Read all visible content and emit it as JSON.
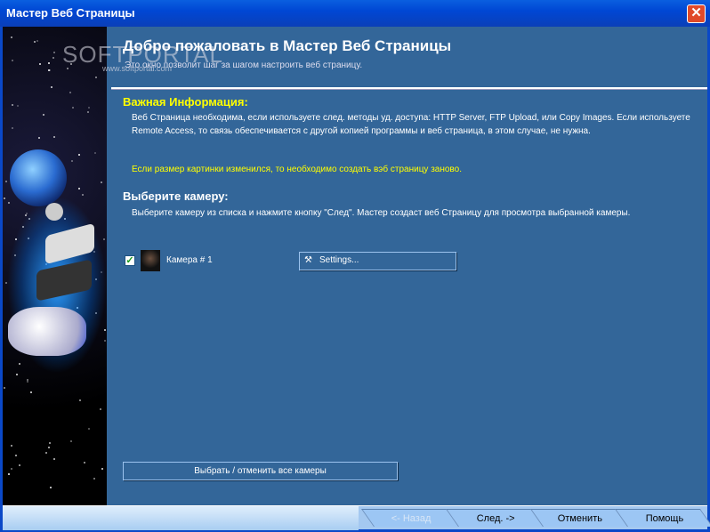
{
  "window": {
    "title": "Мастер Веб Страницы",
    "close": "✕"
  },
  "watermark": {
    "logo": "SOFTPORTAL",
    "url": "www.softportal.com"
  },
  "header": {
    "title": "Добро пожаловать в Мастер Веб Страницы",
    "subtitle": "Это окно позволит шаг за шагом настроить веб страницу."
  },
  "info": {
    "heading": "Важная Информация:",
    "text": "Веб Страница необходима, если используете след. методы уд. доступа: HTTP Server, FTP Upload, или Copy Images. Если используете Remote Access, то связь обеспечивается с другой копией программы и веб страница, в этом случае, не нужна.",
    "warning": "Если размер картинки изменился, то необходимо создать вэб страницу заново."
  },
  "camera": {
    "heading": "Выберите камеру:",
    "text": "Выберите камеру из списка и нажмите кнопку \"След\". Мастер создаст веб Страницу для просмотра выбранной камеры.",
    "items": [
      {
        "label": "Камера # 1",
        "checked": true
      }
    ],
    "settings_label": "Settings...",
    "select_all_label": "Выбрать / отменить все камеры"
  },
  "nav": {
    "back": "<- Назад",
    "next": "След. ->",
    "cancel": "Отменить",
    "help": "Помощь"
  }
}
